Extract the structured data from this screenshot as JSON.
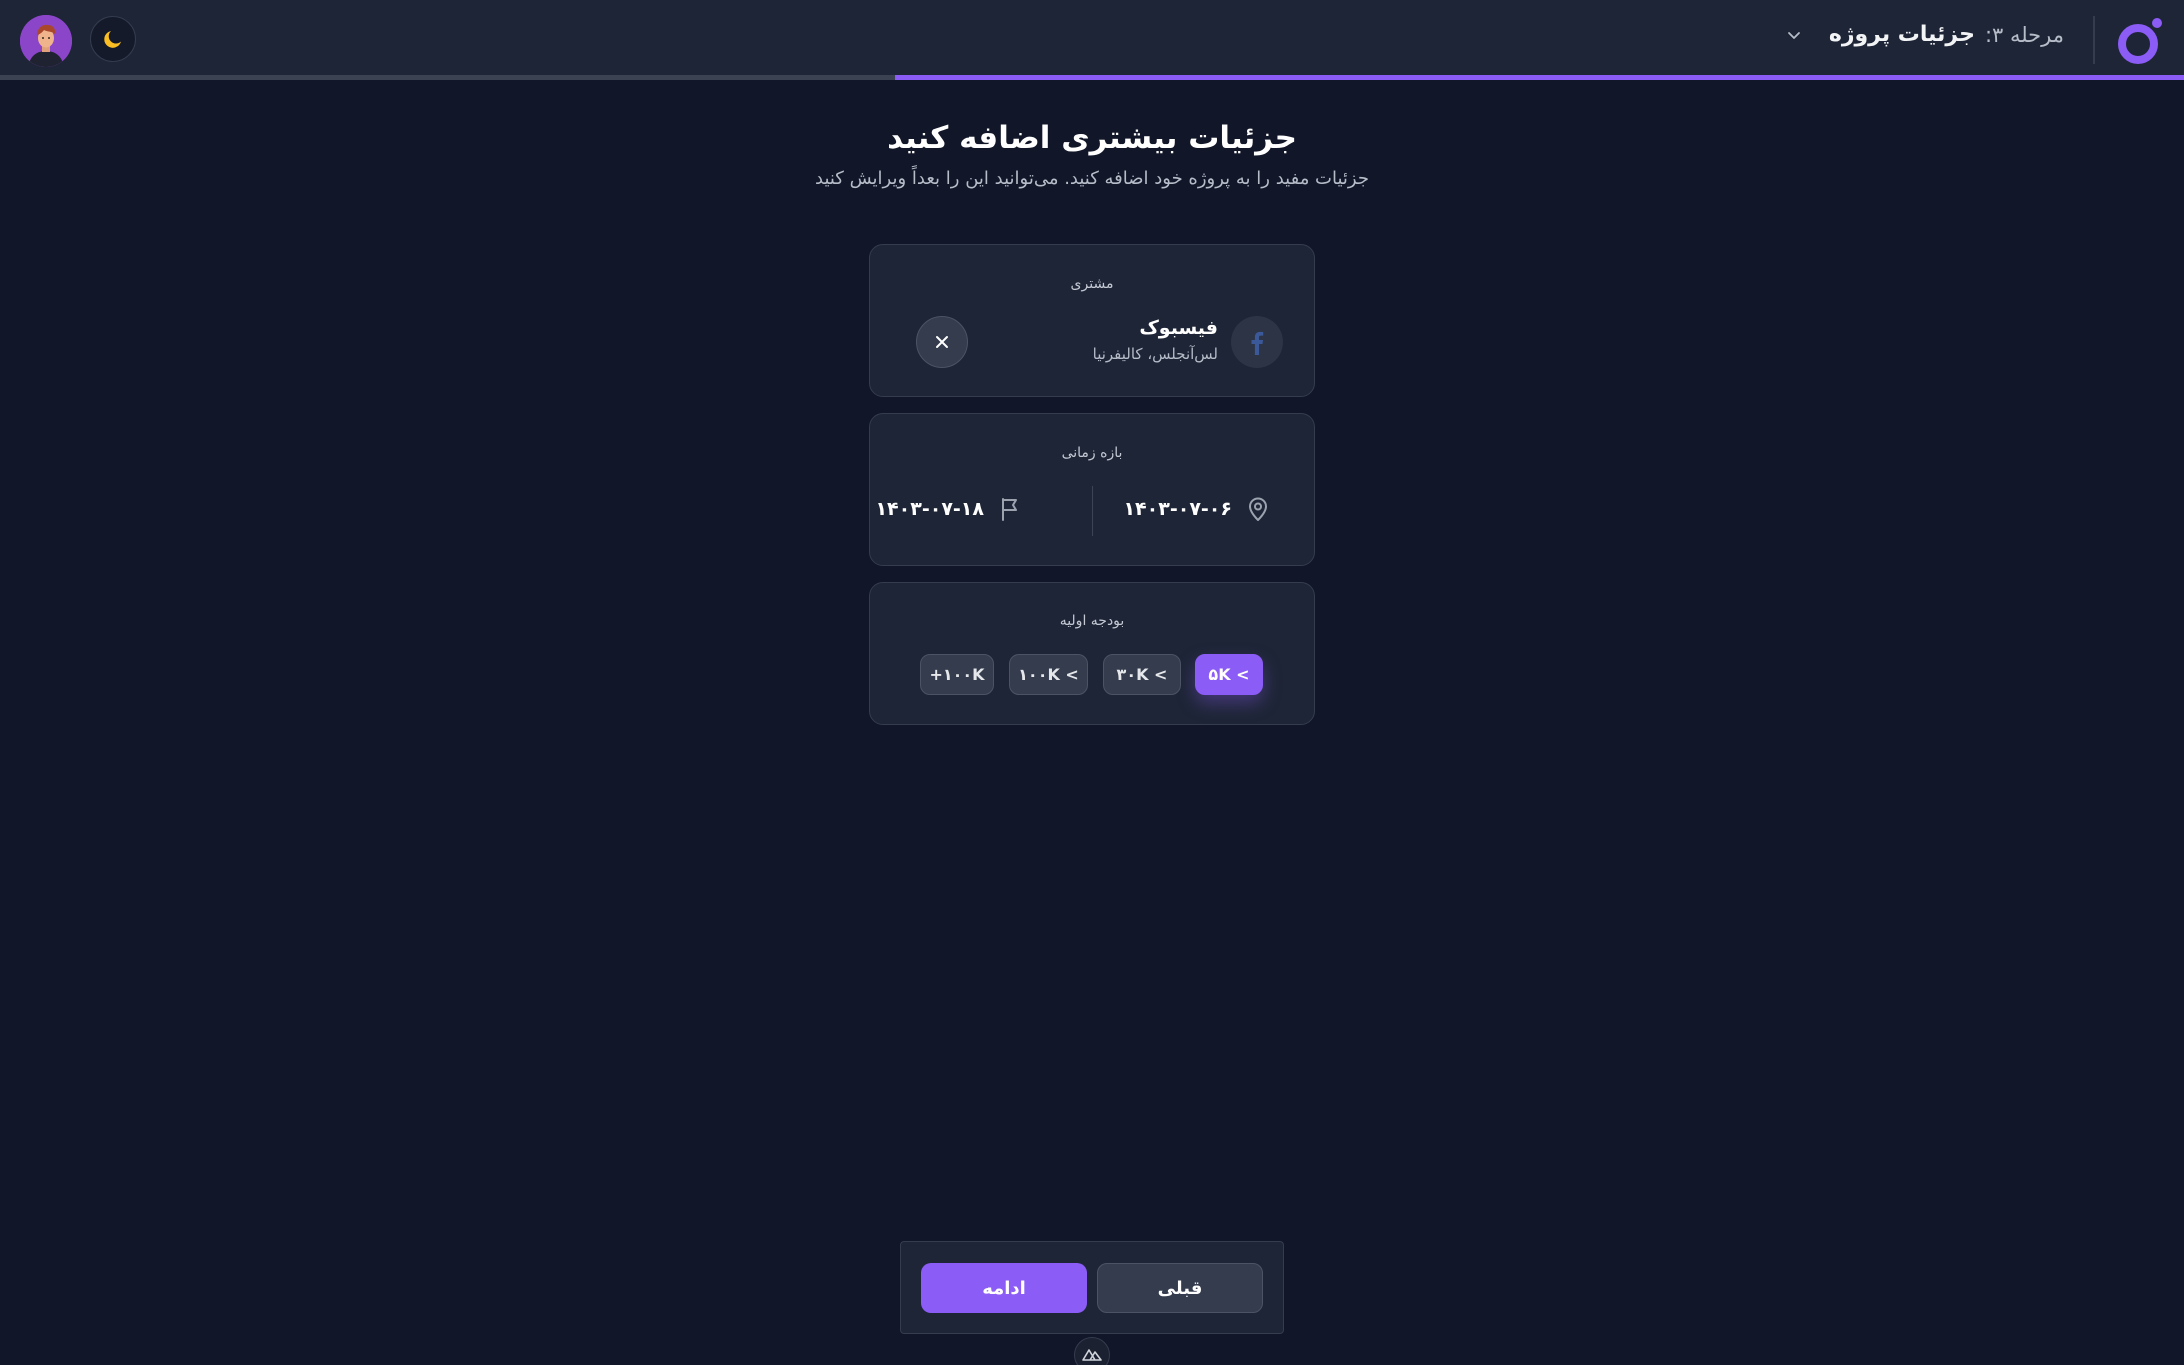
{
  "header": {
    "logo_icon": "brand-logo-icon",
    "step_label": "مرحله ۳:",
    "step_title": "جزئیات پروژه",
    "progress": 0.59,
    "theme_icon": "moon-icon",
    "avatar_icon": "user-avatar"
  },
  "main": {
    "title": "جزئیات بیشتری اضافه کنید",
    "subtitle": "جزئیات مفید را به پروژه خود اضافه کنید. می‌توانید این را بعداً ویرایش کنید"
  },
  "client": {
    "label": "مشتری",
    "name": "فیسبوک",
    "location": "لس‌آنجلس، کالیفرنیا",
    "icon": "facebook-icon"
  },
  "timeframe": {
    "label": "بازه زمانی",
    "start_date": "۱۴۰۳-۰۷-۰۶",
    "end_date": "۱۴۰۳-۰۷-۱۸"
  },
  "budget": {
    "label": "بودجه اولیه",
    "options": [
      "5K >",
      "30K >",
      "100K >",
      "100K+"
    ],
    "options_display": [
      "۵K <",
      "۳۰K <",
      "۱۰۰K <",
      "+۱۰۰K"
    ],
    "selected_index": 0
  },
  "footer": {
    "next_label": "ادامه",
    "prev_label": "قبلی"
  },
  "colors": {
    "accent": "#8b5cf6",
    "background": "#111628",
    "card": "#1e2536"
  }
}
